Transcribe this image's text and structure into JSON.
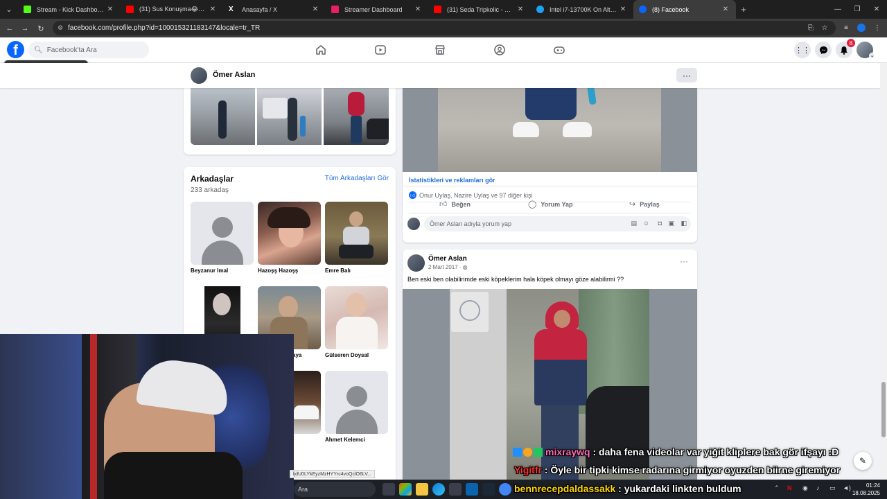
{
  "browser": {
    "tabs": [
      {
        "title": "Stream - Kick Dashboard",
        "color": "#53fc18",
        "active": false
      },
      {
        "title": "(31) Sus Konuşma😂Gora Kam",
        "color": "#ff0000",
        "active": false
      },
      {
        "title": "Anasayfa / X",
        "color": "#ffffff",
        "active": false
      },
      {
        "title": "Streamer Dashboard",
        "color": "#e91e63",
        "active": false
      },
      {
        "title": "(31) Seda Tripkolic - Gözlerinin",
        "color": "#ff0000",
        "active": false
      },
      {
        "title": "Intel i7-13700K On Altı Çekirde",
        "color": "#1da1f2",
        "active": false
      },
      {
        "title": "(8) Facebook",
        "color": "#0866ff",
        "active": true
      }
    ],
    "url": "facebook.com/profile.php?id=100015321183147&locale=tr_TR"
  },
  "fb": {
    "logo": "f",
    "search_placeholder": "Facebook'ta Ara",
    "notif_count": "8",
    "tooltip": "Kapatmak için Esc tuşuna bas"
  },
  "profile": {
    "name": "Ömer Aslan"
  },
  "friends": {
    "title": "Arkadaşlar",
    "count": "233 arkadaş",
    "see_all": "Tüm Arkadaşları Gör",
    "items": [
      {
        "name": "Beyzanur Imal"
      },
      {
        "name": "Hazoşş Hazoşş"
      },
      {
        "name": "Emre Balı"
      },
      {
        "name": ""
      },
      {
        "name": "aya"
      },
      {
        "name": "Gülseren Doysal"
      },
      {
        "name": ""
      },
      {
        "name": ""
      },
      {
        "name": "Ahmet Kelemci"
      }
    ]
  },
  "post1": {
    "stats_link": "İstatistikleri ve reklamları gör",
    "reactions": "Onur Uylaş, Nazire Uylaş ve 97 diğer kişi",
    "like": "Beğen",
    "comment": "Yorum Yap",
    "share": "Paylaş",
    "comment_placeholder": "Ömer Aslan adıyla yorum yap"
  },
  "post2": {
    "author": "Ömer Aslan",
    "date": "2 Mart 2017 · ",
    "text": "Ben eski ben olabilirimde eski köpeklerim hala köpek olmayı göze alabilirmi ??"
  },
  "chat": {
    "line1_user": "mixraywq",
    "line1_msg": " : daha fena videolar var yiğit kliplere bak gör ifşayı :D",
    "line2_user": "Yigitfr",
    "line2_msg": " : Öyle bir tipki kimse radarına girmiyor oyuzden biirne giremiyor",
    "line3_user": "bennrecepdaldassakk",
    "line3_msg": " : yukardaki linkten buldum"
  },
  "statusbar_url": "ljdU0LYkEyzMzHYYrc4voQclO6LV...",
  "taskbar": {
    "search_label": "Ara",
    "time": "01:24",
    "date": "18.08.2025"
  },
  "colors": {
    "fb_blue": "#0866ff",
    "link_blue": "#216fdb",
    "chat_user1": "#ff69b4",
    "chat_user2": "#ff3030",
    "chat_user3": "#ffd700"
  }
}
